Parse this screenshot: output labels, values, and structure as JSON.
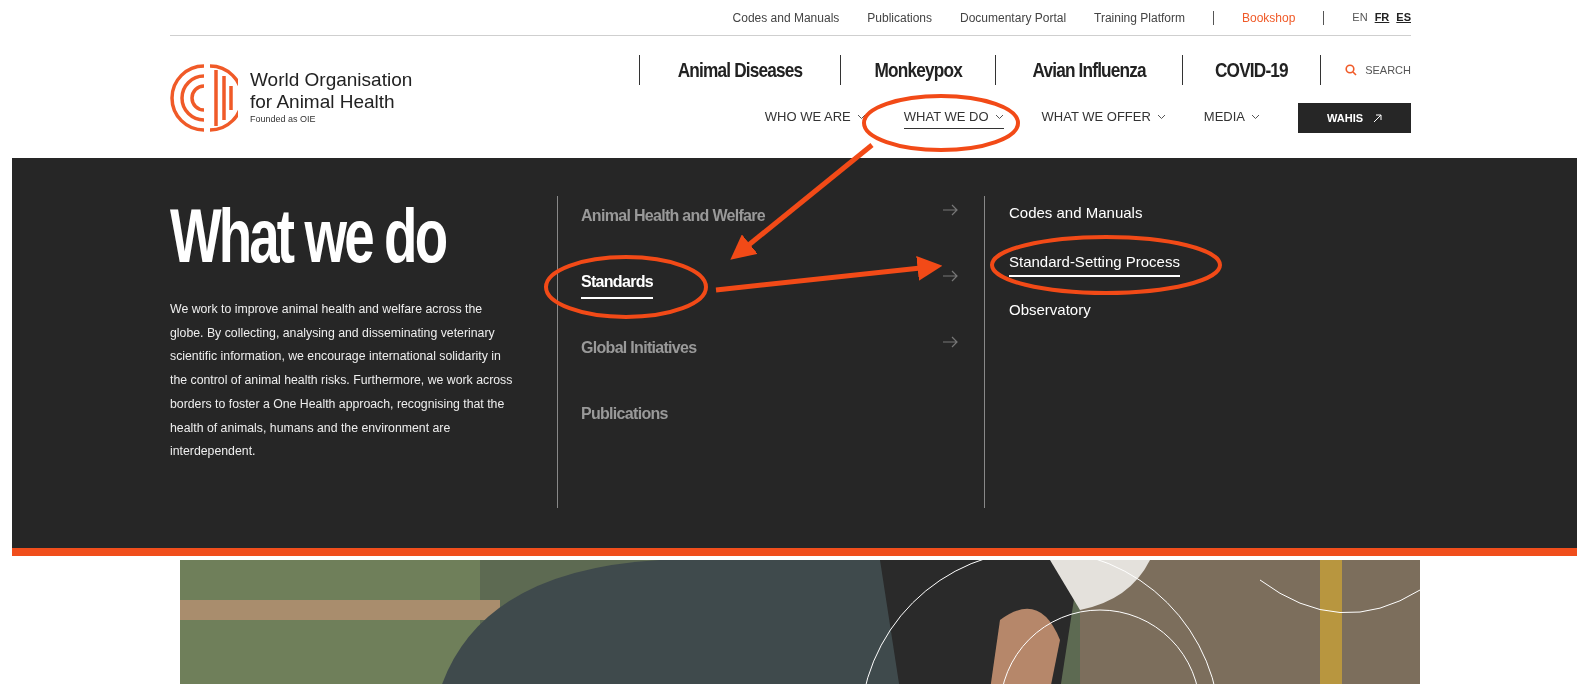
{
  "top_links": [
    {
      "label": "Codes and Manuals",
      "kind": "link"
    },
    {
      "label": "Publications",
      "kind": "link"
    },
    {
      "label": "Documentary Portal",
      "kind": "link"
    },
    {
      "label": "Training Platform",
      "kind": "link"
    },
    {
      "label": "Bookshop",
      "kind": "accent"
    }
  ],
  "languages": [
    {
      "label": "EN",
      "selected": true
    },
    {
      "label": "FR",
      "selected": false
    },
    {
      "label": "ES",
      "selected": false
    }
  ],
  "logo": {
    "name_line_1": "World Organisation",
    "name_line_2": "for Animal Health",
    "tagline": "Founded as OIE"
  },
  "featured_links": [
    "Animal Diseases",
    "Monkeypox",
    "Avian Influenza",
    "COVID-19"
  ],
  "search": {
    "label": "SEARCH"
  },
  "main_nav": [
    {
      "label": "WHO WE ARE",
      "selected": false
    },
    {
      "label": "WHAT WE DO",
      "selected": true
    },
    {
      "label": "WHAT WE OFFER",
      "selected": false
    },
    {
      "label": "MEDIA",
      "selected": false
    }
  ],
  "wahis_button": {
    "label": "WAHIS"
  },
  "mega_menu": {
    "title": "What we do",
    "description": "We work to improve animal health and welfare across the globe. By collecting, analysing and disseminating veterinary scientific information, we encourage international solidarity in the control of animal health risks. Furthermore, we work across borders to foster a One Health approach, recognising that the health of animals, humans and the environment are interdependent.",
    "items": [
      {
        "label": "Animal Health and Welfare",
        "selected": false,
        "has_arrow": true
      },
      {
        "label": "Standards",
        "selected": true,
        "has_arrow": true
      },
      {
        "label": "Global Initiatives",
        "selected": false,
        "has_arrow": true
      },
      {
        "label": "Publications",
        "selected": false,
        "has_arrow": false
      }
    ],
    "subitems": [
      {
        "label": "Codes and Manuals",
        "selected": false
      },
      {
        "label": "Standard-Setting Process",
        "selected": true
      },
      {
        "label": "Observatory",
        "selected": false
      }
    ]
  },
  "hero": {
    "kind": "picture"
  }
}
